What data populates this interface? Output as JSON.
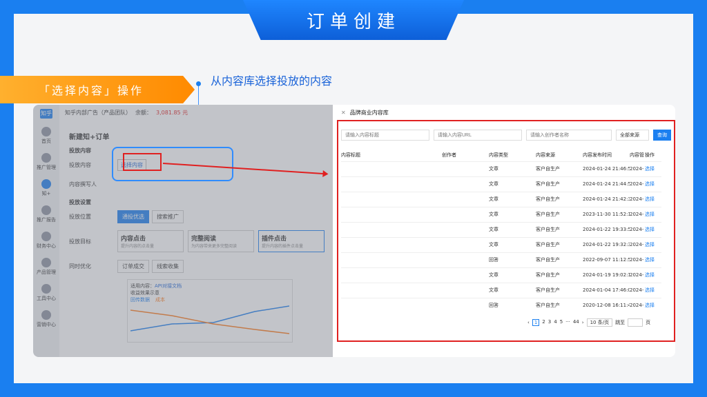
{
  "slide": {
    "title": "订单创建",
    "step_label": "「选择内容」操作",
    "caption": "从内容库选择投放的内容"
  },
  "app": {
    "logo": "知乎",
    "account": "知乎内部广告（产品团队）",
    "balance_label": "余额：",
    "balance_value": "3,081.85 元",
    "sidebar": [
      {
        "label": "首页"
      },
      {
        "label": "推广管理"
      },
      {
        "label": "知+"
      },
      {
        "label": "推广报告"
      },
      {
        "label": "财务中心"
      },
      {
        "label": "产品管理"
      },
      {
        "label": "工具中心"
      },
      {
        "label": "营销中心"
      }
    ],
    "page_title": "新建知+订单",
    "section1": "投放内容",
    "row_content_label": "投放内容",
    "select_content_btn": "选择内容",
    "row_author_label": "内容撰写人",
    "section2": "投放设置",
    "row_position_label": "投放位置",
    "pos_tab1": "通投优选",
    "pos_tab2": "搜索推广",
    "row_goal_label": "投放目标",
    "goal1_title": "内容点击",
    "goal1_desc": "提升内容的点击量",
    "goal2_title": "完整阅读",
    "goal2_desc": "为内容带来更多完整阅读",
    "goal3_title": "插件点击",
    "goal3_desc": "提升内容的插件点击量",
    "row_sync_label": "同时优化",
    "sync1": "订单成交",
    "sync2": "线索收集",
    "usage_title": "适用内容：",
    "usage_link": "API对接文档",
    "chart_legend_1": "回传数据",
    "chart_legend_2": "成本",
    "effect_label": "收益效果示意"
  },
  "dialog": {
    "title": "品牌商业内容库",
    "filter_title_ph": "请输入内容标题",
    "filter_url_ph": "请输入内容URL",
    "filter_author_ph": "请输入创作者名称",
    "filter_source": "全部来源",
    "query_btn": "查询",
    "columns": [
      "内容标题",
      "创作者",
      "内容类型",
      "内容来源",
      "内容发布时间",
      "内容管",
      "操作"
    ],
    "rows": [
      {
        "title": "",
        "author": "",
        "type": "文章",
        "source": "客户自生产",
        "time": "2024-01-24 21:46:51",
        "col6": "2024-",
        "action": "选择"
      },
      {
        "title": "",
        "author": "",
        "type": "文章",
        "source": "客户自生产",
        "time": "2024-01-24 21:44:58",
        "col6": "2024-",
        "action": "选择"
      },
      {
        "title": "",
        "author": "",
        "type": "文章",
        "source": "客户自生产",
        "time": "2024-01-24 21:42:32",
        "col6": "2024-",
        "action": "选择"
      },
      {
        "title": "",
        "author": "",
        "type": "文章",
        "source": "客户自生产",
        "time": "2023-11-30 11:52:19",
        "col6": "2024-",
        "action": "选择"
      },
      {
        "title": "",
        "author": "",
        "type": "文章",
        "source": "客户自生产",
        "time": "2024-01-22 19:33:54",
        "col6": "2024-",
        "action": "选择"
      },
      {
        "title": "",
        "author": "",
        "type": "文章",
        "source": "客户自生产",
        "time": "2024-01-22 19:32:34",
        "col6": "2024-",
        "action": "选择"
      },
      {
        "title": "",
        "author": "",
        "type": "回答",
        "source": "客户自生产",
        "time": "2022-09-07 11:12:52",
        "col6": "2024-",
        "action": "选择"
      },
      {
        "title": "",
        "author": "",
        "type": "文章",
        "source": "客户自生产",
        "time": "2024-01-19 19:02:14",
        "col6": "2024-",
        "action": "选择"
      },
      {
        "title": "",
        "author": "",
        "type": "文章",
        "source": "客户自生产",
        "time": "2024-01-04 17:46:00",
        "col6": "2024-",
        "action": "选择"
      },
      {
        "title": "",
        "author": "",
        "type": "回答",
        "source": "客户自生产",
        "time": "2020-12-08 16:11:43",
        "col6": "2024-",
        "action": "选择"
      }
    ],
    "pager": {
      "pages": [
        "1",
        "2",
        "3",
        "4",
        "5",
        "···",
        "44"
      ],
      "page_size": "10 条/页",
      "jump_label": "跳至",
      "page_suffix": "页"
    }
  }
}
